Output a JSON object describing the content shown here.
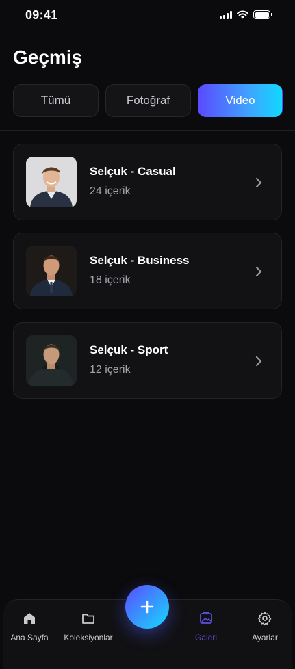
{
  "status_bar": {
    "time": "09:41"
  },
  "page": {
    "title": "Geçmiş"
  },
  "tabs": [
    {
      "label": "Tümü",
      "active": false
    },
    {
      "label": "Fotoğraf",
      "active": false
    },
    {
      "label": "Video",
      "active": true
    }
  ],
  "collections": [
    {
      "title": "Selçuk - Casual",
      "subtitle": "24 içerik",
      "avatar": "man-casual-photo"
    },
    {
      "title": "Selçuk - Business",
      "subtitle": "18 içerik",
      "avatar": "man-business-photo"
    },
    {
      "title": "Selçuk - Sport",
      "subtitle": "12 içerik",
      "avatar": "man-sport-photo"
    }
  ],
  "bottom_nav": {
    "items": [
      {
        "label": "Ana Sayfa",
        "icon": "home-icon"
      },
      {
        "label": "Koleksiyonlar",
        "icon": "folder-icon"
      },
      {
        "label": "Galeri",
        "icon": "gallery-icon",
        "active": true
      },
      {
        "label": "Ayarlar",
        "icon": "gear-icon"
      }
    ],
    "fab_icon": "plus-icon"
  },
  "colors": {
    "background": "#0b0b0d",
    "accent_start": "#5a4bff",
    "accent_end": "#12d8ff",
    "active_nav": "#5b4fe0"
  }
}
